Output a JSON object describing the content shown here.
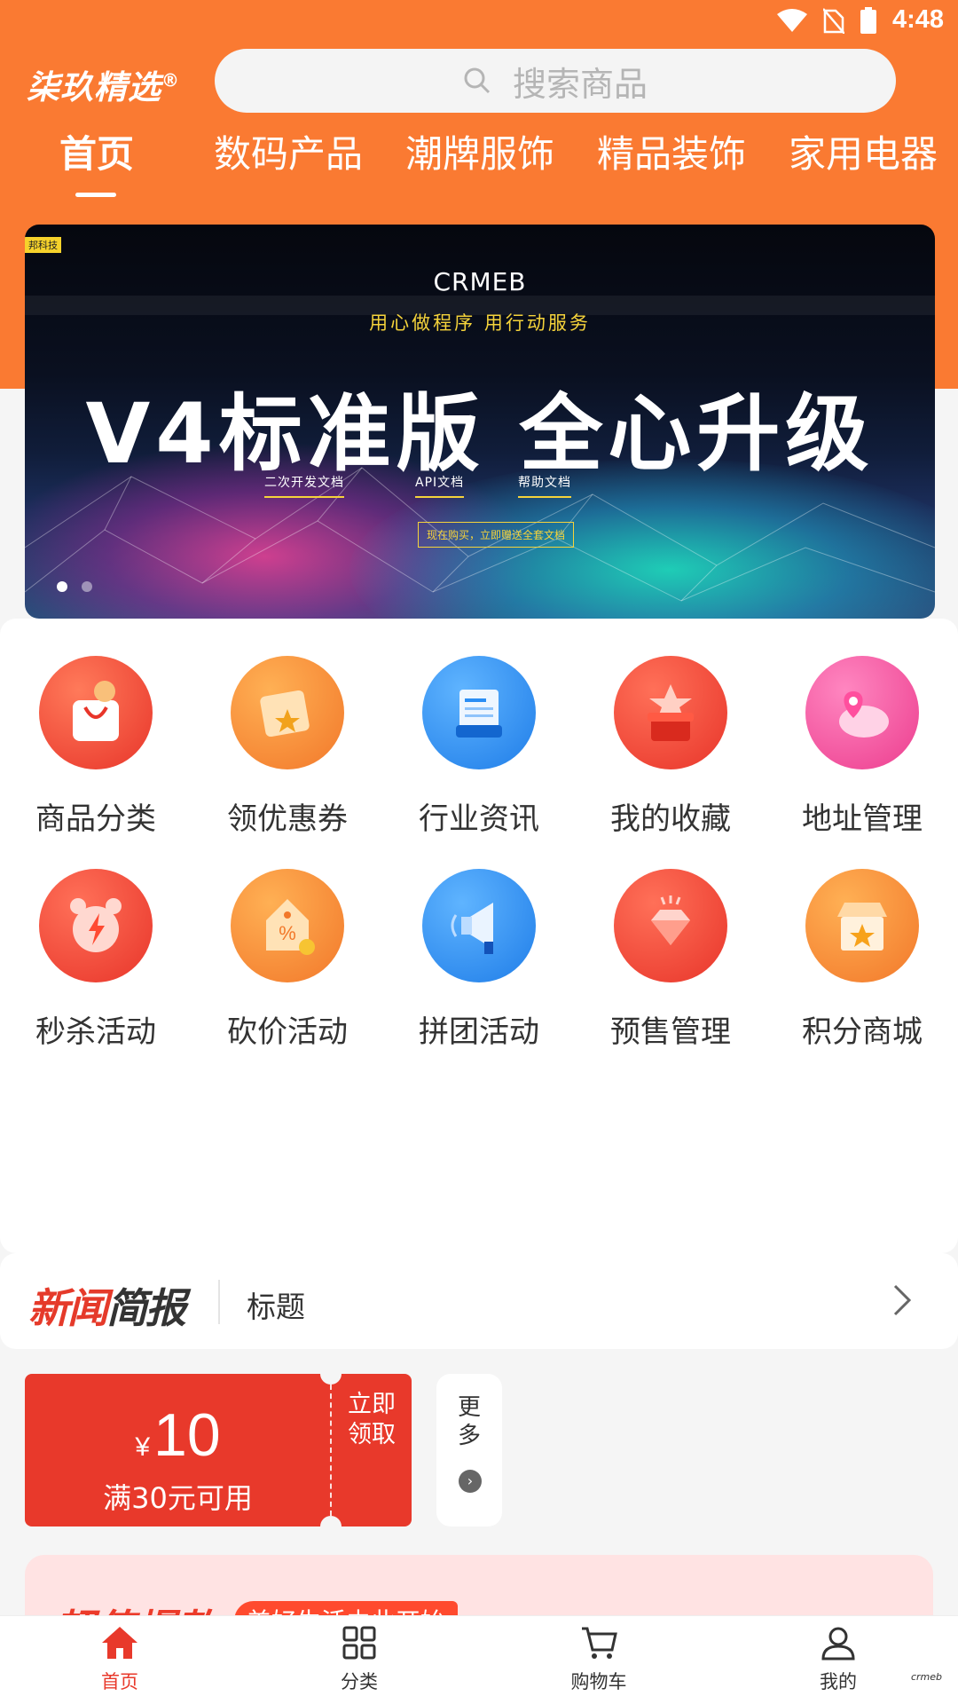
{
  "status_bar": {
    "time": "4:48",
    "icons": [
      "wifi-icon",
      "no-sim-icon",
      "battery-icon"
    ]
  },
  "header": {
    "logo": "柒玖精选",
    "logo_mark": "®",
    "search_placeholder": "搜索商品",
    "tabs": [
      {
        "label": "首页",
        "active": true
      },
      {
        "label": "数码产品"
      },
      {
        "label": "潮牌服饰"
      },
      {
        "label": "精品装饰"
      },
      {
        "label": "家用电器"
      }
    ]
  },
  "banner": {
    "badge": "邦科技",
    "brand": "CRMEB",
    "slogan": "用心做程序 用行动服务",
    "headline": "V4标准版 全心升级",
    "links": [
      "二次开发文档",
      "API文档",
      "帮助文档"
    ],
    "cta": "现在购买，立即赠送全套文档",
    "dots": 2,
    "active_dot": 0
  },
  "menu": {
    "items": [
      {
        "label": "商品分类",
        "icon": "shopping-bag-icon",
        "color": "#f04a32"
      },
      {
        "label": "领优惠券",
        "icon": "coupon-icon",
        "color": "#fa8a2a"
      },
      {
        "label": "行业资讯",
        "icon": "news-icon",
        "color": "#2b8ef4"
      },
      {
        "label": "我的收藏",
        "icon": "favorite-box-icon",
        "color": "#f04a32"
      },
      {
        "label": "地址管理",
        "icon": "location-icon",
        "color": "#f0449a"
      },
      {
        "label": "秒杀活动",
        "icon": "alarm-clock-icon",
        "color": "#f04a32"
      },
      {
        "label": "砍价活动",
        "icon": "price-tag-icon",
        "color": "#fa8a2a"
      },
      {
        "label": "拼团活动",
        "icon": "megaphone-icon",
        "color": "#2b8ef4"
      },
      {
        "label": "预售管理",
        "icon": "diamond-icon",
        "color": "#f04a32"
      },
      {
        "label": "积分商城",
        "icon": "store-icon",
        "color": "#fa8a2a"
      }
    ]
  },
  "news": {
    "logo_red": "新闻",
    "logo_dark": "简报",
    "title": "标题"
  },
  "coupon": {
    "currency": "¥",
    "amount": "10",
    "condition": "满30元可用",
    "action": "立即领取"
  },
  "more": {
    "label": "更多"
  },
  "hot_sale": {
    "title": "超值爆款",
    "tag": "美好生活由此开始"
  },
  "bottom_nav": {
    "items": [
      {
        "label": "首页",
        "icon": "home-icon",
        "active": true
      },
      {
        "label": "分类",
        "icon": "grid-icon"
      },
      {
        "label": "购物车",
        "icon": "cart-icon"
      },
      {
        "label": "我的",
        "icon": "user-icon"
      }
    ],
    "watermark": "crmeb"
  },
  "colors": {
    "brand_orange": "#fa7a32",
    "accent_red": "#e8392b"
  }
}
